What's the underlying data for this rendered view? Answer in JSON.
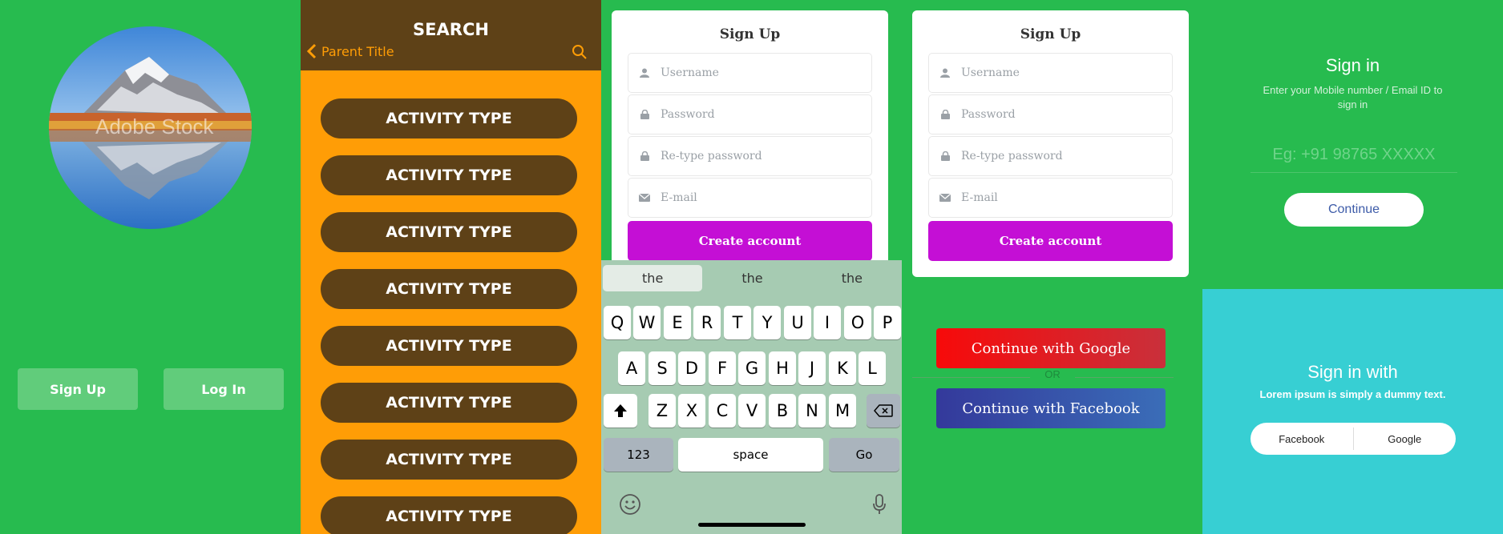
{
  "panel1": {
    "photo_watermark": "Adobe Stock",
    "signup_label": "Sign Up",
    "login_label": "Log In"
  },
  "panel2": {
    "title": "SEARCH",
    "back_label": "Parent Title",
    "items": [
      "ACTIVITY TYPE",
      "ACTIVITY TYPE",
      "ACTIVITY TYPE",
      "ACTIVITY TYPE",
      "ACTIVITY TYPE",
      "ACTIVITY TYPE",
      "ACTIVITY TYPE",
      "ACTIVITY TYPE"
    ]
  },
  "signup_form_a": {
    "title": "Sign Up",
    "username_placeholder": "Username",
    "password_placeholder": "Password",
    "retype_placeholder": "Re-type password",
    "email_placeholder": "E-mail",
    "create_label": "Create account"
  },
  "signup_form_b": {
    "title": "Sign Up",
    "username_placeholder": "Username",
    "password_placeholder": "Password",
    "retype_placeholder": "Re-type password",
    "email_placeholder": "E-mail",
    "create_label": "Create account"
  },
  "keyboard": {
    "suggestions": [
      "the",
      "the",
      "the"
    ],
    "row1": [
      "Q",
      "W",
      "E",
      "R",
      "T",
      "Y",
      "U",
      "I",
      "O",
      "P"
    ],
    "row2": [
      "A",
      "S",
      "D",
      "F",
      "G",
      "H",
      "J",
      "K",
      "L"
    ],
    "row3": [
      "Z",
      "X",
      "C",
      "V",
      "B",
      "N",
      "M"
    ],
    "numbers_label": "123",
    "space_label": "space",
    "go_label": "Go"
  },
  "social": {
    "google_label": "Continue with Google",
    "or_label": "OR",
    "facebook_label": "Continue with Facebook"
  },
  "signin": {
    "title": "Sign in",
    "subtitle": "Enter your Mobile number / Email ID to sign in",
    "phone_placeholder": "Eg: +91 98765 XXXXX",
    "continue_label": "Continue"
  },
  "signin_with": {
    "title": "Sign in with",
    "subtitle": "Lorem ipsum is simply a dummy text.",
    "facebook_label": "Facebook",
    "google_label": "Google"
  },
  "colors": {
    "green_bg": "#27bb4f",
    "orange_bg": "#ff9d06",
    "brown": "#5e4117",
    "magenta": "#c40fd5",
    "google_red": "#e81317",
    "facebook_blue": "#34399b",
    "teal": "#37cfd3"
  }
}
